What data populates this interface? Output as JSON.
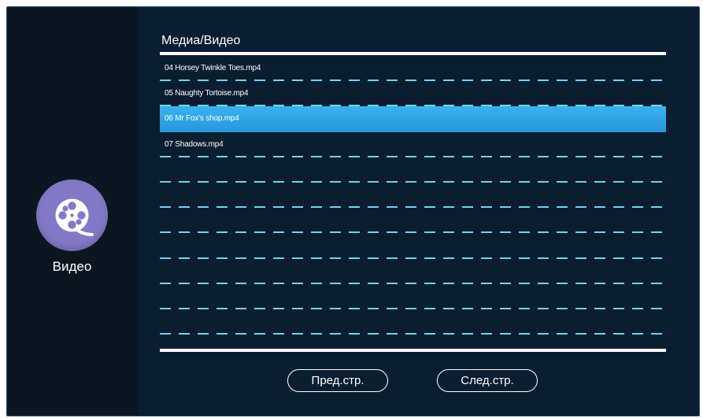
{
  "sidebar": {
    "icon": "film-reel-icon",
    "label": "Видео",
    "icon_color": "#8279c6"
  },
  "main": {
    "title": "Медиа/Видео",
    "items": [
      {
        "label": "04 Horsey Twinkle Toes.mp4",
        "selected": false
      },
      {
        "label": "05 Naughty Tortoise.mp4",
        "selected": false
      },
      {
        "label": "06 Mr Fox's shop.mp4",
        "selected": true
      },
      {
        "label": "07 Shadows.mp4",
        "selected": false
      },
      {
        "label": "",
        "selected": false
      },
      {
        "label": "",
        "selected": false
      },
      {
        "label": "",
        "selected": false
      },
      {
        "label": "",
        "selected": false
      },
      {
        "label": "",
        "selected": false
      },
      {
        "label": "",
        "selected": false
      },
      {
        "label": "",
        "selected": false
      }
    ]
  },
  "pager": {
    "prev_label": "Пред.стр.",
    "next_label": "След.стр."
  },
  "colors": {
    "background": "#0a1e30",
    "sidebar": "#0c1620",
    "selection": "#2fa4e6",
    "divider": "#6fd3ee"
  }
}
